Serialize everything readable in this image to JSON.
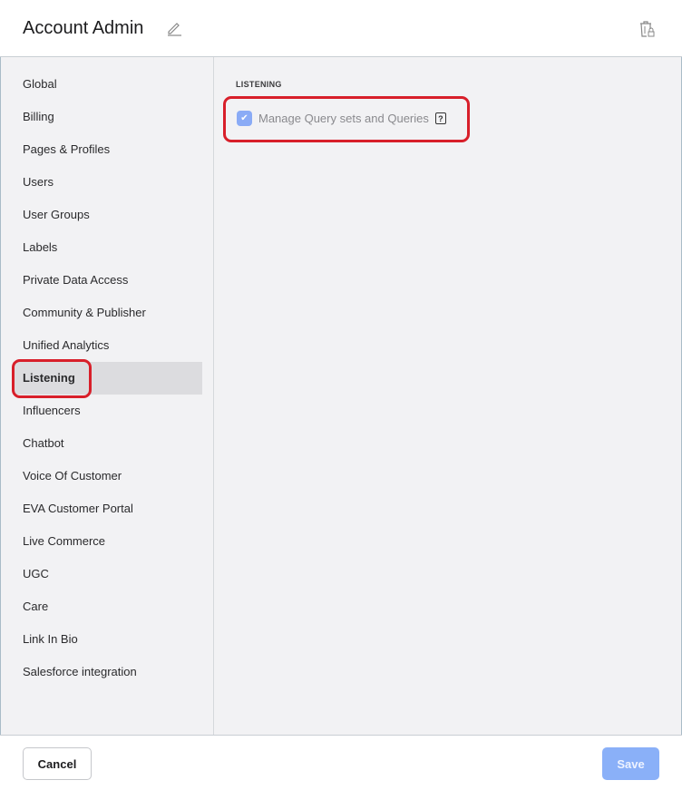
{
  "header": {
    "title": "Account Admin",
    "edit_icon": "pencil-icon",
    "delete_icon": "trash-lock-icon"
  },
  "sidebar": {
    "items": [
      {
        "label": "Global"
      },
      {
        "label": "Billing"
      },
      {
        "label": "Pages & Profiles"
      },
      {
        "label": "Users"
      },
      {
        "label": "User Groups"
      },
      {
        "label": "Labels"
      },
      {
        "label": "Private Data Access"
      },
      {
        "label": "Community & Publisher"
      },
      {
        "label": "Unified Analytics"
      },
      {
        "label": "Listening",
        "active": true
      },
      {
        "label": "Influencers"
      },
      {
        "label": "Chatbot"
      },
      {
        "label": "Voice Of Customer"
      },
      {
        "label": "EVA Customer Portal"
      },
      {
        "label": "Live Commerce"
      },
      {
        "label": "UGC"
      },
      {
        "label": "Care"
      },
      {
        "label": "Link In Bio"
      },
      {
        "label": "Salesforce integration"
      }
    ]
  },
  "main": {
    "section_title": "LISTENING",
    "permissions": [
      {
        "label": "Manage Query sets and Queries",
        "checked": true,
        "help": "?"
      }
    ]
  },
  "footer": {
    "cancel_label": "Cancel",
    "save_label": "Save"
  },
  "colors": {
    "accent": "#8ab0f8",
    "highlight": "#d81f2a"
  }
}
